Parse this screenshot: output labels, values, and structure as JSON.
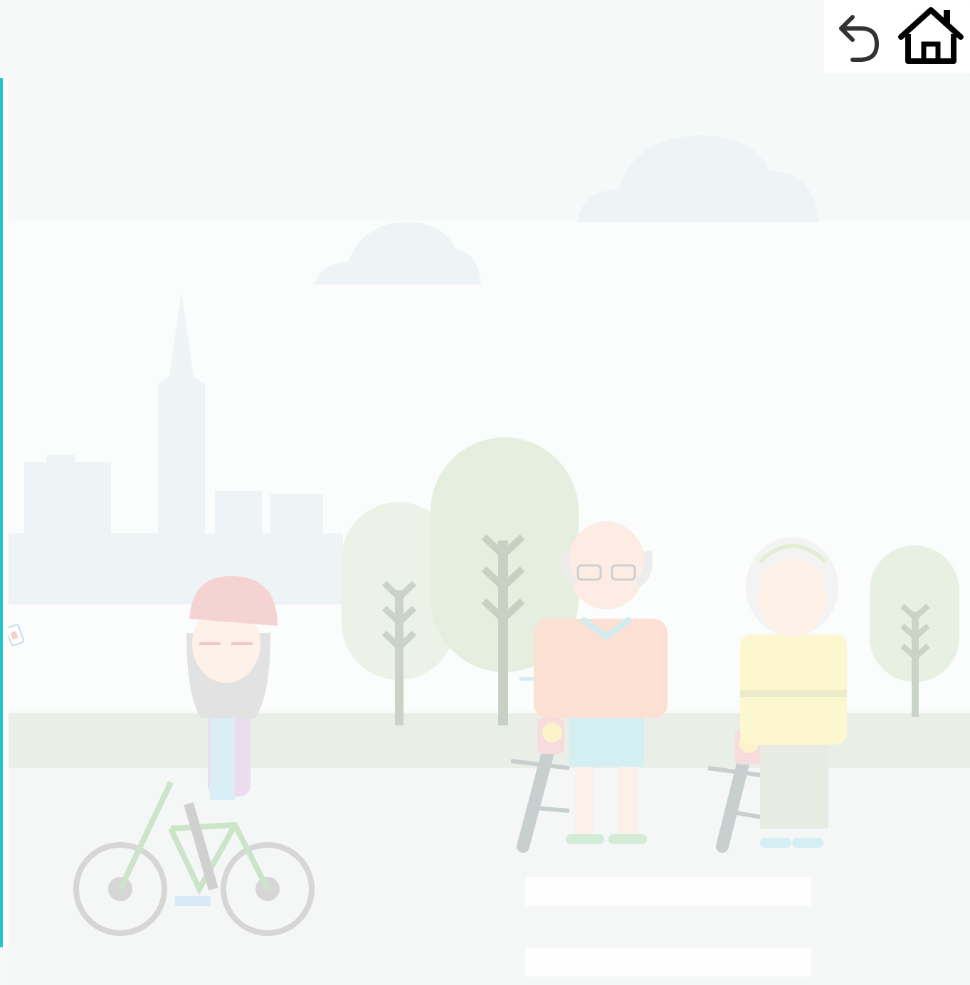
{
  "toolbar": {
    "undo_icon": "undo-arrow-icon",
    "home_icon": "home-icon"
  },
  "scene": {
    "description_icon": "park-cyclists-illustration",
    "left_marker_icon": "small-card-icon"
  },
  "colors": {
    "accent": "#27c3c9",
    "background": "#f7f8f8"
  }
}
